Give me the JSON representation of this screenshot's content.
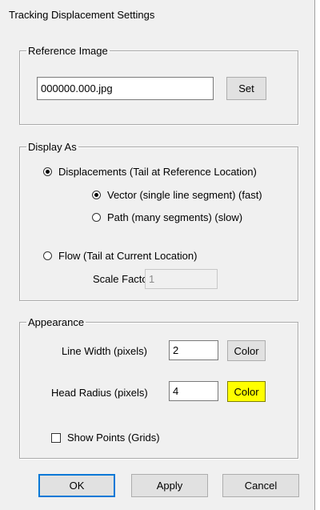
{
  "window": {
    "title": "Tracking Displacement Settings"
  },
  "reference_image": {
    "legend": "Reference Image",
    "filename": "000000.000.jpg",
    "set_label": "Set"
  },
  "display_as": {
    "legend": "Display As",
    "displacements_label": "Displacements (Tail at Reference Location)",
    "displacements_selected": true,
    "vector_label": "Vector (single line segment) (fast)",
    "vector_selected": true,
    "path_label": "Path (many segments) (slow)",
    "path_selected": false,
    "flow_label": "Flow (Tail at Current Location)",
    "flow_selected": false,
    "scale_factor_label": "Scale Factor",
    "scale_factor_value": "1"
  },
  "appearance": {
    "legend": "Appearance",
    "line_width_label": "Line Width (pixels)",
    "line_width_value": "2",
    "line_color_label": "Color",
    "head_radius_label": "Head Radius (pixels)",
    "head_radius_value": "4",
    "head_color_label": "Color",
    "head_color": "#ffff00",
    "show_points_label": "Show Points (Grids)",
    "show_points_checked": false
  },
  "buttons": {
    "ok": "OK",
    "apply": "Apply",
    "cancel": "Cancel"
  }
}
